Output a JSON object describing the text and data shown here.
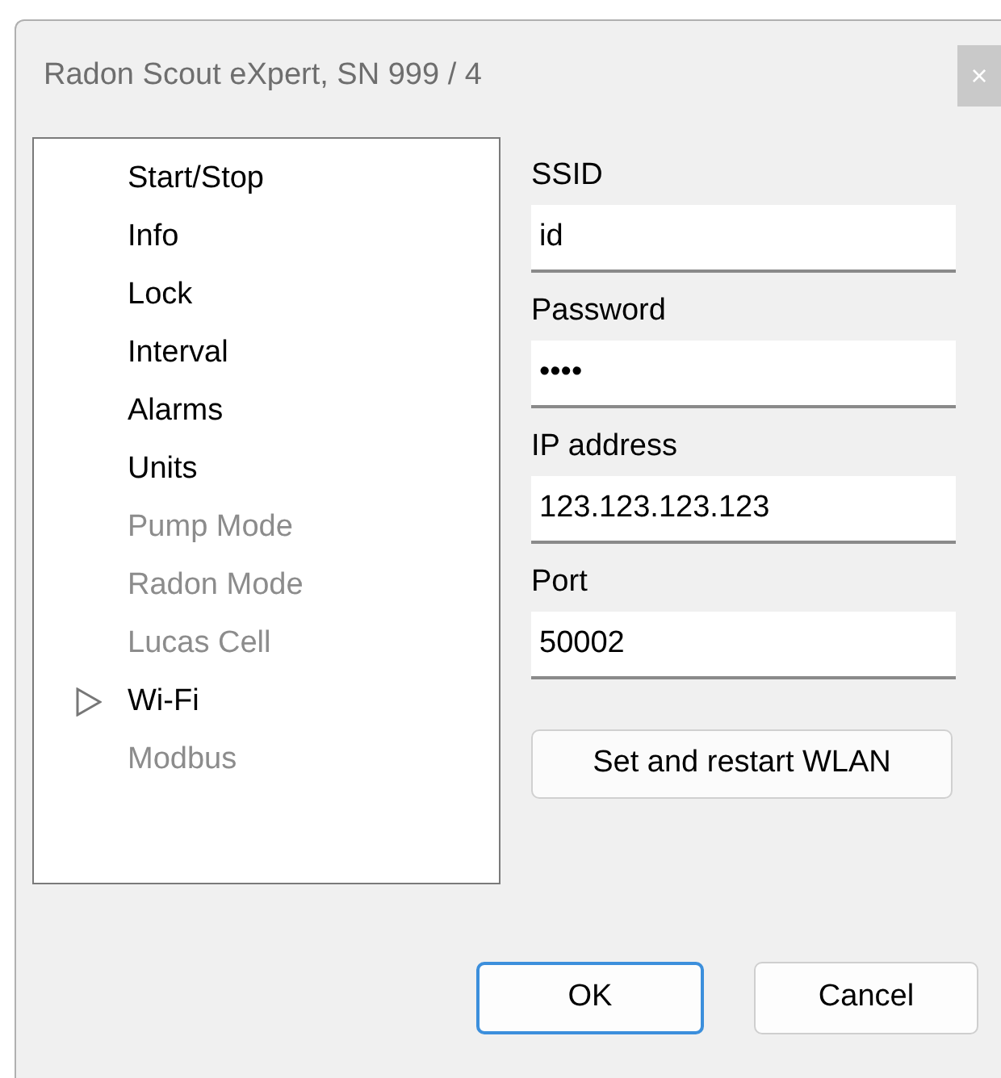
{
  "window": {
    "title": "Radon Scout eXpert, SN 999 / 4",
    "close": "×"
  },
  "sidebar": {
    "items": [
      {
        "label": "Start/Stop",
        "disabled": false,
        "selected": false
      },
      {
        "label": "Info",
        "disabled": false,
        "selected": false
      },
      {
        "label": "Lock",
        "disabled": false,
        "selected": false
      },
      {
        "label": "Interval",
        "disabled": false,
        "selected": false
      },
      {
        "label": "Alarms",
        "disabled": false,
        "selected": false
      },
      {
        "label": "Units",
        "disabled": false,
        "selected": false
      },
      {
        "label": "Pump Mode",
        "disabled": true,
        "selected": false
      },
      {
        "label": "Radon Mode",
        "disabled": true,
        "selected": false
      },
      {
        "label": "Lucas Cell",
        "disabled": true,
        "selected": false
      },
      {
        "label": "Wi-Fi",
        "disabled": false,
        "selected": true
      },
      {
        "label": "Modbus",
        "disabled": true,
        "selected": false
      }
    ]
  },
  "fields": [
    {
      "label": "SSID",
      "value": "id"
    },
    {
      "label": "Password",
      "value": "••••"
    },
    {
      "label": "IP address",
      "value": "123.123.123.123"
    },
    {
      "label": "Port",
      "value": "50002"
    }
  ],
  "action_button": "Set and restart WLAN",
  "buttons": [
    {
      "label": "OK",
      "default": true
    },
    {
      "label": "Cancel",
      "default": false
    }
  ]
}
